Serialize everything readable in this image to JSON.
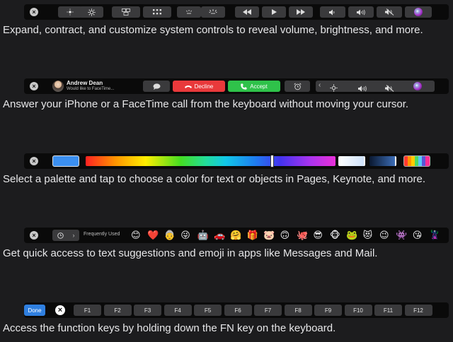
{
  "sections": [
    {
      "caption": "Expand, contract, and customize system controls to reveal volume, brightness, and more."
    },
    {
      "caption": "Answer your iPhone or a FaceTime call from the keyboard without moving your cursor."
    },
    {
      "caption": "Select a palette and tap to choose a color for text or objects in Pages, Keynote, and more."
    },
    {
      "caption": "Get quick access to text suggestions and emoji in apps like Messages and Mail."
    },
    {
      "caption": "Access the function keys by holding down the FN key on the keyboard."
    }
  ],
  "call": {
    "caller_name": "Andrew Dean",
    "caller_subtitle": "Would like to FaceTime...",
    "decline_label": "Decline",
    "accept_label": "Accept",
    "decline_color": "#e9393b",
    "accept_color": "#2fc24a"
  },
  "emoji_bar": {
    "category_label": "Frequently Used",
    "emojis": [
      "😊",
      "❤️",
      "👵",
      "😜",
      "🤖",
      "🚗",
      "🤗",
      "🎁",
      "🐷",
      "🙃",
      "🐙",
      "😎",
      "🐵",
      "🐸",
      "😻",
      "😉",
      "👾",
      "😘",
      "🦹"
    ]
  },
  "fn_bar": {
    "done_label": "Done",
    "done_color": "#2f7fe0",
    "keys": [
      "F1",
      "F2",
      "F3",
      "F4",
      "F5",
      "F6",
      "F7",
      "F8",
      "F9",
      "F10",
      "F11",
      "F12"
    ]
  },
  "colors": {
    "selected_swatch": "#3b8ff0"
  }
}
